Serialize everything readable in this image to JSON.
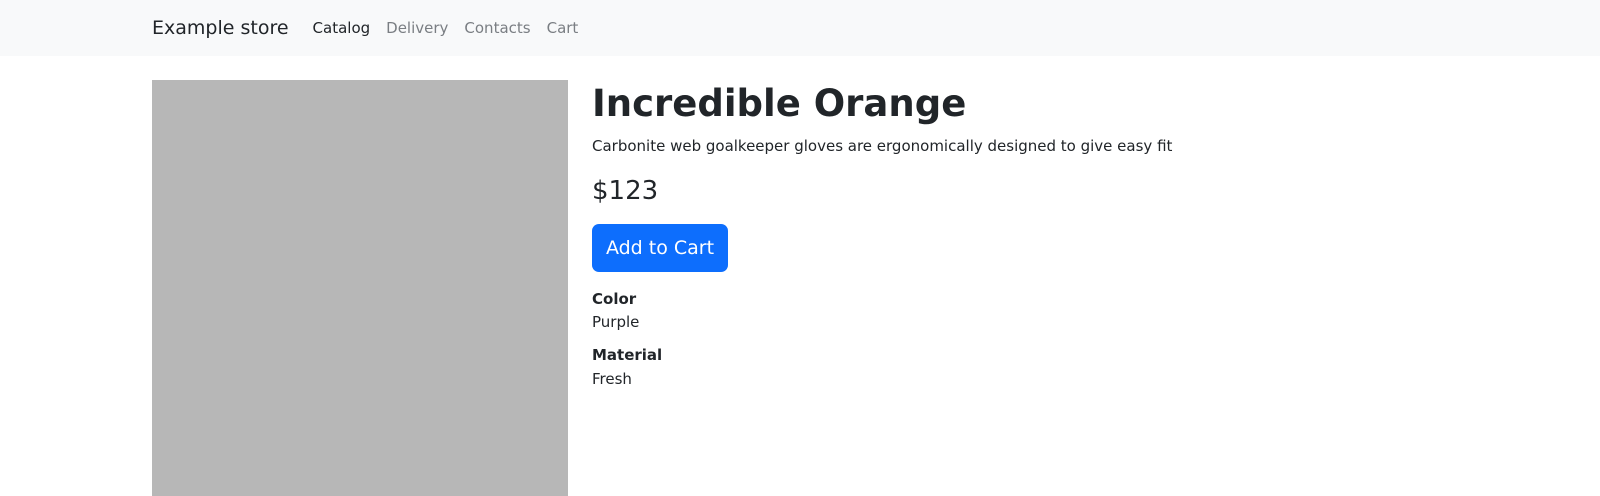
{
  "navbar": {
    "brand": "Example store",
    "links": [
      {
        "label": "Catalog",
        "active": true
      },
      {
        "label": "Delivery",
        "active": false
      },
      {
        "label": "Contacts",
        "active": false
      },
      {
        "label": "Cart",
        "active": false
      }
    ]
  },
  "product": {
    "title": "Incredible Orange",
    "description": "Carbonite web goalkeeper gloves are ergonomically designed to give easy fit",
    "price": "$123",
    "add_to_cart_label": "Add to Cart",
    "attributes": [
      {
        "label": "Color",
        "value": "Purple"
      },
      {
        "label": "Material",
        "value": "Fresh"
      }
    ]
  },
  "colors": {
    "navbar_bg": "#f8f9fa",
    "image_placeholder": "#b7b7b7",
    "primary_button": "#0d6efd",
    "text": "#212529",
    "muted_link": "#7a7e83"
  }
}
